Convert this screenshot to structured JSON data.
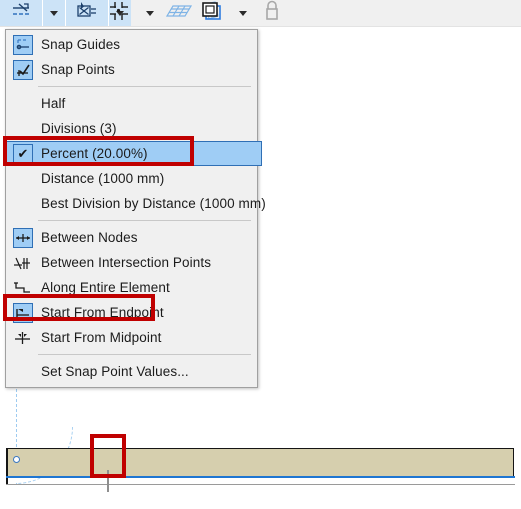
{
  "app": {
    "title": "Snap Points and Guides toolbar",
    "accent_highlight": "#9fcdf5",
    "accent_border": "#2f6fb5",
    "annotation_color": "#c00000",
    "toolbar_bg": "#f0f0f0",
    "menu_bg": "#f0f0f0",
    "wall_fill": "#d6cfae",
    "wall_reference_line": "#1f76d2",
    "guide_color": "#9ecbf0"
  },
  "toolbar": {
    "items": [
      {
        "name": "snap-guides-button",
        "icon": "snap-guides-icon",
        "active": true,
        "label": "Snap Guides"
      },
      {
        "name": "snap-guides-dropdown",
        "icon": "chevron-down-icon",
        "active": true,
        "label": "Snap Guides options"
      },
      {
        "name": "snap-points-button",
        "icon": "snap-points-icon",
        "active": true,
        "label": "Snap Points"
      },
      {
        "name": "snap-points-dropdown",
        "icon": "chevron-down-icon",
        "active": true,
        "label": "Snap Points options"
      },
      {
        "name": "grid-snap-button",
        "icon": "grid-snap-icon",
        "active": false,
        "label": "Grid Snap"
      },
      {
        "name": "grid-snap-dropdown",
        "icon": "chevron-down-icon",
        "active": false,
        "label": "Grid Snap options"
      },
      {
        "name": "construction-grid-button",
        "icon": "construction-grid-icon",
        "active": false,
        "label": "Construction Grid"
      },
      {
        "name": "rotated-grid-button",
        "icon": "rotated-grid-icon",
        "active": false,
        "label": "Rotated Grid"
      },
      {
        "name": "layers-button",
        "icon": "layers-icon",
        "active": false,
        "label": "Layers"
      },
      {
        "name": "layers-dropdown",
        "icon": "chevron-down-icon",
        "active": false,
        "label": "Layers options"
      },
      {
        "name": "lock-button",
        "icon": "padlock-icon",
        "active": false,
        "label": "Lock"
      }
    ]
  },
  "menu": {
    "name": "snap-points-menu",
    "items": [
      {
        "type": "item",
        "label": "Snap Guides",
        "icon": "snap-guides-icon",
        "icon_boxed": true,
        "checked": false,
        "name": "menu-item-snap-guides"
      },
      {
        "type": "item",
        "label": "Snap Points",
        "icon": "snap-points-icon",
        "icon_boxed": true,
        "checked": false,
        "name": "menu-item-snap-points"
      },
      {
        "type": "separator",
        "name": "menu-separator-1"
      },
      {
        "type": "item",
        "label": "Half",
        "icon": "",
        "icon_boxed": false,
        "checked": false,
        "name": "menu-item-half"
      },
      {
        "type": "item",
        "label": "Divisions (3)",
        "icon": "",
        "icon_boxed": false,
        "checked": false,
        "name": "menu-item-divisions"
      },
      {
        "type": "item",
        "label": "Percent (20.00%)",
        "icon": "check-icon",
        "icon_boxed": true,
        "checked": true,
        "name": "menu-item-percent",
        "selected": true,
        "annotated": true
      },
      {
        "type": "item",
        "label": "Distance (1000 mm)",
        "icon": "",
        "icon_boxed": false,
        "checked": false,
        "name": "menu-item-distance"
      },
      {
        "type": "item",
        "label": "Best Division by Distance (1000 mm)",
        "icon": "",
        "icon_boxed": false,
        "checked": false,
        "name": "menu-item-best-division-by-distance"
      },
      {
        "type": "separator",
        "name": "menu-separator-2"
      },
      {
        "type": "item",
        "label": "Between Nodes",
        "icon": "between-nodes-icon",
        "icon_boxed": true,
        "checked": false,
        "name": "menu-item-between-nodes"
      },
      {
        "type": "item",
        "label": "Between Intersection Points",
        "icon": "between-intersections-icon",
        "icon_boxed": false,
        "checked": false,
        "name": "menu-item-between-intersection-points"
      },
      {
        "type": "item",
        "label": "Along Entire Element",
        "icon": "along-entire-element-icon",
        "icon_boxed": false,
        "checked": false,
        "name": "menu-item-along-entire-element"
      },
      {
        "type": "item",
        "label": "Start From Endpoint",
        "icon": "start-from-endpoint-icon",
        "icon_boxed": true,
        "checked": false,
        "name": "menu-item-start-from-endpoint",
        "annotated": true
      },
      {
        "type": "item",
        "label": "Start From Midpoint",
        "icon": "start-from-midpoint-icon",
        "icon_boxed": false,
        "checked": false,
        "name": "menu-item-start-from-midpoint"
      },
      {
        "type": "separator",
        "name": "menu-separator-3"
      },
      {
        "type": "item",
        "label": "Set Snap Point Values...",
        "icon": "",
        "icon_boxed": false,
        "checked": false,
        "name": "menu-item-set-snap-point-values"
      }
    ]
  },
  "canvas": {
    "name": "floor-plan-canvas",
    "elements": [
      {
        "name": "wall-element",
        "label": "Wall"
      },
      {
        "name": "wall-reference-line",
        "label": "Reference line"
      },
      {
        "name": "snap-point-marker",
        "label": "Snap point marker"
      },
      {
        "name": "snap-guide-line",
        "label": "Snap guide"
      },
      {
        "name": "snap-guide-arc",
        "label": "Snap guide arc"
      },
      {
        "name": "wall-node",
        "label": "Wall node"
      }
    ]
  },
  "annotations": [
    {
      "name": "annotation-percent-row",
      "target": "menu-item-percent"
    },
    {
      "name": "annotation-endpoint-row",
      "target": "menu-item-start-from-endpoint"
    },
    {
      "name": "annotation-snap-marker",
      "target": "snap-point-marker"
    }
  ]
}
